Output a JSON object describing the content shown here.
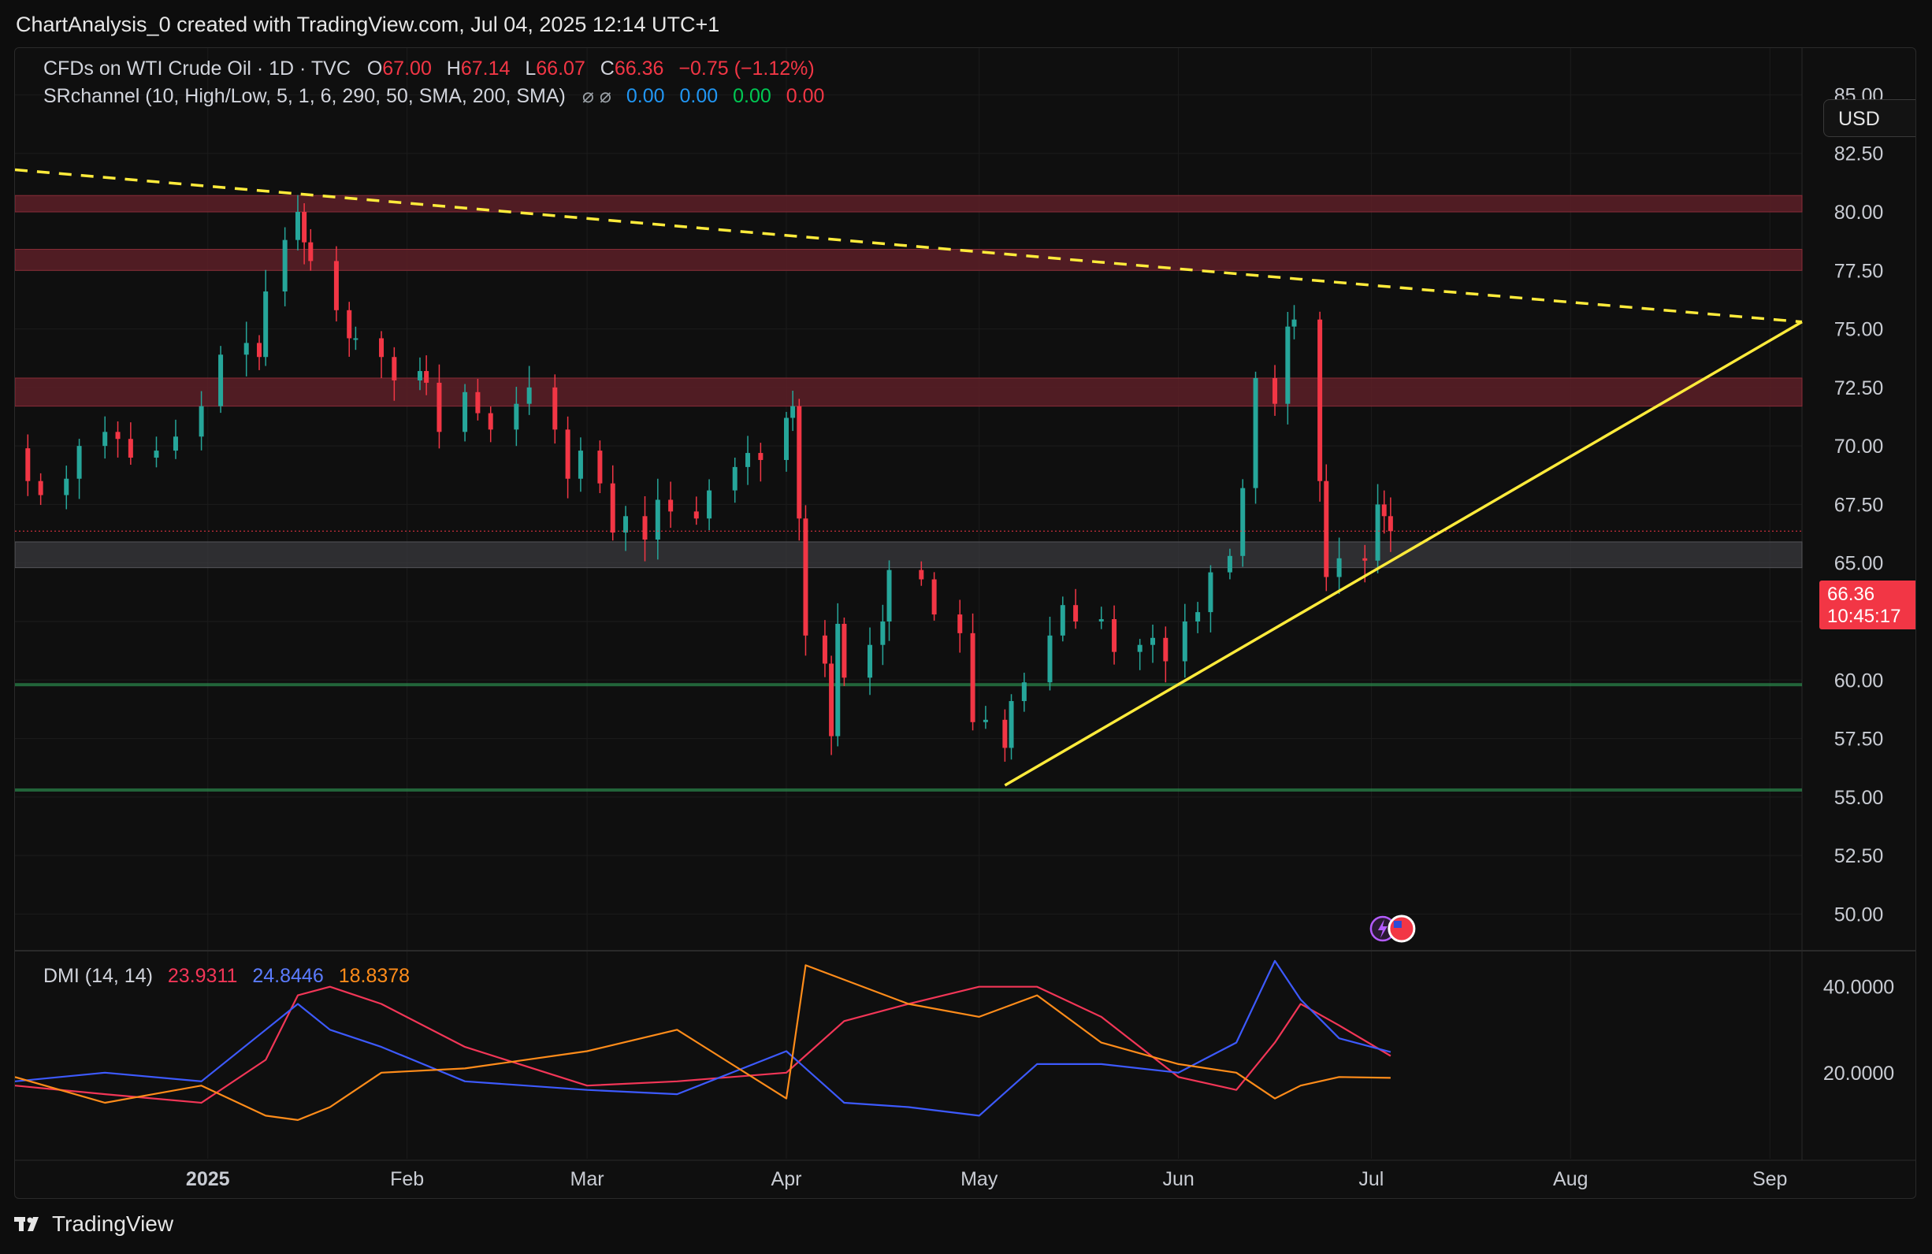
{
  "header": {
    "created_line": "ChartAnalysis_0 created with TradingView.com, Jul 04, 2025 12:14 UTC+1"
  },
  "legend": {
    "symbol": "CFDs on WTI Crude Oil · 1D · TVC",
    "o_label": "O",
    "o_value": "67.00",
    "h_label": "H",
    "h_value": "67.14",
    "l_label": "L",
    "l_value": "66.07",
    "c_label": "C",
    "c_value": "66.36",
    "change": "−0.75 (−1.12%)",
    "indicator": "SRchannel (10, High/Low, 5, 1, 6, 290, 50, SMA, 200, SMA)",
    "indicator_icons": "⌀ ⌀",
    "ind_v1": "0.00",
    "ind_v2": "0.00",
    "ind_v3": "0.00",
    "ind_v4": "0.00"
  },
  "currency_button": "USD",
  "last_price": {
    "value": "66.36",
    "countdown": "10:45:17"
  },
  "dmi_legend": {
    "name": "DMI (14, 14)",
    "plus_di": "23.9311",
    "minus_di": "24.8446",
    "adx": "18.8378"
  },
  "footer": {
    "brand": "TradingView"
  },
  "colors": {
    "up": "#26a69a",
    "down": "#f23645",
    "trend": "#ffeb3b",
    "resistance_zone": "#5c1f27",
    "support_line": "#2e9e57",
    "plus_di": "#f23657",
    "minus_di": "#3d5afe",
    "adx": "#ff8c1a"
  },
  "chart_data": [
    {
      "type": "candlestick",
      "x_axis_labels": [
        "2025",
        "Feb",
        "Mar",
        "Apr",
        "May",
        "Jun",
        "Jul",
        "Aug",
        "Sep"
      ],
      "x_axis_dates": [
        "2025-01-01",
        "2025-02-01",
        "2025-03-01",
        "2025-04-01",
        "2025-05-01",
        "2025-06-01",
        "2025-07-01",
        "2025-08-01",
        "2025-09-01"
      ],
      "y_axis_ticks": [
        "85.00",
        "82.50",
        "80.00",
        "77.50",
        "75.00",
        "72.50",
        "70.00",
        "67.50",
        "65.00",
        "62.50",
        "60.00",
        "57.50",
        "55.00",
        "52.50",
        "50.00"
      ],
      "ylim": [
        48.5,
        87
      ],
      "xlim": [
        "2024-12-02",
        "2025-09-06"
      ],
      "closes": [
        [
          "2024-12-02",
          69.9
        ],
        [
          "2024-12-04",
          68.5
        ],
        [
          "2024-12-06",
          67.9
        ],
        [
          "2024-12-10",
          68.6
        ],
        [
          "2024-12-12",
          70.0
        ],
        [
          "2024-12-16",
          70.6
        ],
        [
          "2024-12-18",
          70.3
        ],
        [
          "2024-12-20",
          69.5
        ],
        [
          "2024-12-24",
          69.8
        ],
        [
          "2024-12-27",
          70.4
        ],
        [
          "2024-12-31",
          71.7
        ],
        [
          "2025-01-03",
          73.9
        ],
        [
          "2025-01-07",
          74.4
        ],
        [
          "2025-01-09",
          73.8
        ],
        [
          "2025-01-10",
          76.6
        ],
        [
          "2025-01-13",
          78.8
        ],
        [
          "2025-01-15",
          80.0
        ],
        [
          "2025-01-16",
          78.7
        ],
        [
          "2025-01-17",
          77.9
        ],
        [
          "2025-01-21",
          75.8
        ],
        [
          "2025-01-23",
          74.6
        ],
        [
          "2025-01-24",
          74.6
        ],
        [
          "2025-01-28",
          73.8
        ],
        [
          "2025-01-30",
          72.8
        ],
        [
          "2025-02-03",
          73.2
        ],
        [
          "2025-02-04",
          72.7
        ],
        [
          "2025-02-06",
          70.6
        ],
        [
          "2025-02-10",
          72.3
        ],
        [
          "2025-02-12",
          71.4
        ],
        [
          "2025-02-14",
          70.7
        ],
        [
          "2025-02-18",
          71.8
        ],
        [
          "2025-02-20",
          72.5
        ],
        [
          "2025-02-24",
          70.7
        ],
        [
          "2025-02-26",
          68.6
        ],
        [
          "2025-02-28",
          69.8
        ],
        [
          "2025-03-03",
          68.4
        ],
        [
          "2025-03-05",
          66.3
        ],
        [
          "2025-03-07",
          67.0
        ],
        [
          "2025-03-10",
          66.0
        ],
        [
          "2025-03-12",
          67.7
        ],
        [
          "2025-03-14",
          67.2
        ],
        [
          "2025-03-18",
          66.9
        ],
        [
          "2025-03-20",
          68.1
        ],
        [
          "2025-03-24",
          69.1
        ],
        [
          "2025-03-26",
          69.7
        ],
        [
          "2025-03-28",
          69.4
        ],
        [
          "2025-04-01",
          71.2
        ],
        [
          "2025-04-02",
          71.7
        ],
        [
          "2025-04-03",
          66.9
        ],
        [
          "2025-04-04",
          61.9
        ],
        [
          "2025-04-07",
          60.7
        ],
        [
          "2025-04-08",
          57.6
        ],
        [
          "2025-04-09",
          62.4
        ],
        [
          "2025-04-10",
          60.1
        ],
        [
          "2025-04-14",
          61.5
        ],
        [
          "2025-04-16",
          62.5
        ],
        [
          "2025-04-17",
          64.7
        ],
        [
          "2025-04-22",
          64.3
        ],
        [
          "2025-04-24",
          62.8
        ],
        [
          "2025-04-28",
          62.0
        ],
        [
          "2025-04-30",
          58.2
        ],
        [
          "2025-05-02",
          58.3
        ],
        [
          "2025-05-05",
          57.1
        ],
        [
          "2025-05-06",
          59.1
        ],
        [
          "2025-05-08",
          59.9
        ],
        [
          "2025-05-12",
          61.9
        ],
        [
          "2025-05-14",
          63.2
        ],
        [
          "2025-05-16",
          62.5
        ],
        [
          "2025-05-20",
          62.6
        ],
        [
          "2025-05-22",
          61.2
        ],
        [
          "2025-05-26",
          61.5
        ],
        [
          "2025-05-28",
          61.8
        ],
        [
          "2025-05-30",
          60.8
        ],
        [
          "2025-06-02",
          62.5
        ],
        [
          "2025-06-04",
          62.9
        ],
        [
          "2025-06-06",
          64.6
        ],
        [
          "2025-06-09",
          65.3
        ],
        [
          "2025-06-11",
          68.2
        ],
        [
          "2025-06-13",
          72.9
        ],
        [
          "2025-06-16",
          71.8
        ],
        [
          "2025-06-18",
          75.1
        ],
        [
          "2025-06-19",
          75.4
        ],
        [
          "2025-06-23",
          68.5
        ],
        [
          "2025-06-24",
          64.4
        ],
        [
          "2025-06-26",
          65.2
        ],
        [
          "2025-06-30",
          65.1
        ],
        [
          "2025-07-02",
          67.5
        ],
        [
          "2025-07-03",
          67.0
        ],
        [
          "2025-07-04",
          66.36
        ]
      ],
      "resistance_zones": [
        [
          80.0,
          80.7
        ],
        [
          77.5,
          78.4
        ],
        [
          71.7,
          72.9
        ]
      ],
      "current_zone": [
        64.8,
        65.9
      ],
      "support_lines": [
        59.8,
        55.3
      ],
      "descending_trendline": [
        [
          "2024-12-02",
          81.8
        ],
        [
          "2025-09-06",
          75.3
        ]
      ],
      "ascending_trendline": [
        [
          "2025-05-05",
          55.5
        ],
        [
          "2025-09-06",
          75.3
        ]
      ]
    },
    {
      "type": "line",
      "title": "DMI (14, 14)",
      "y_axis_ticks": [
        "40.0000",
        "20.0000"
      ],
      "ylim": [
        0,
        48
      ],
      "series": [
        {
          "name": "+DI",
          "values": [
            [
              "2024-12-02",
              17
            ],
            [
              "2024-12-16",
              15
            ],
            [
              "2024-12-31",
              13
            ],
            [
              "2025-01-10",
              23
            ],
            [
              "2025-01-15",
              38
            ],
            [
              "2025-01-20",
              40
            ],
            [
              "2025-01-28",
              36
            ],
            [
              "2025-02-10",
              26
            ],
            [
              "2025-03-01",
              17
            ],
            [
              "2025-03-15",
              18
            ],
            [
              "2025-04-01",
              20
            ],
            [
              "2025-04-10",
              32
            ],
            [
              "2025-04-20",
              36
            ],
            [
              "2025-05-01",
              40
            ],
            [
              "2025-05-10",
              40
            ],
            [
              "2025-05-20",
              33
            ],
            [
              "2025-06-01",
              19
            ],
            [
              "2025-06-10",
              16
            ],
            [
              "2025-06-16",
              27
            ],
            [
              "2025-06-20",
              36
            ],
            [
              "2025-06-26",
              31
            ],
            [
              "2025-07-04",
              23.9
            ]
          ]
        },
        {
          "name": "−DI",
          "values": [
            [
              "2024-12-02",
              18
            ],
            [
              "2024-12-16",
              20
            ],
            [
              "2024-12-31",
              18
            ],
            [
              "2025-01-10",
              30
            ],
            [
              "2025-01-15",
              36
            ],
            [
              "2025-01-20",
              30
            ],
            [
              "2025-01-28",
              26
            ],
            [
              "2025-02-10",
              18
            ],
            [
              "2025-03-01",
              16
            ],
            [
              "2025-03-15",
              15
            ],
            [
              "2025-04-01",
              25
            ],
            [
              "2025-04-10",
              13
            ],
            [
              "2025-04-20",
              12
            ],
            [
              "2025-05-01",
              10
            ],
            [
              "2025-05-10",
              22
            ],
            [
              "2025-05-20",
              22
            ],
            [
              "2025-06-01",
              20
            ],
            [
              "2025-06-10",
              27
            ],
            [
              "2025-06-16",
              46
            ],
            [
              "2025-06-20",
              37
            ],
            [
              "2025-06-26",
              28
            ],
            [
              "2025-07-04",
              24.8
            ]
          ]
        },
        {
          "name": "ADX",
          "values": [
            [
              "2024-12-02",
              19
            ],
            [
              "2024-12-16",
              13
            ],
            [
              "2024-12-31",
              17
            ],
            [
              "2025-01-10",
              10
            ],
            [
              "2025-01-15",
              9
            ],
            [
              "2025-01-20",
              12
            ],
            [
              "2025-01-28",
              20
            ],
            [
              "2025-02-10",
              21
            ],
            [
              "2025-03-01",
              25
            ],
            [
              "2025-03-15",
              30
            ],
            [
              "2025-04-01",
              14
            ],
            [
              "2025-04-04",
              45
            ],
            [
              "2025-04-20",
              36
            ],
            [
              "2025-05-01",
              33
            ],
            [
              "2025-05-10",
              38
            ],
            [
              "2025-05-20",
              27
            ],
            [
              "2025-06-01",
              22
            ],
            [
              "2025-06-10",
              20
            ],
            [
              "2025-06-16",
              14
            ],
            [
              "2025-06-20",
              17
            ],
            [
              "2025-06-26",
              19
            ],
            [
              "2025-07-04",
              18.8
            ]
          ]
        }
      ]
    }
  ]
}
